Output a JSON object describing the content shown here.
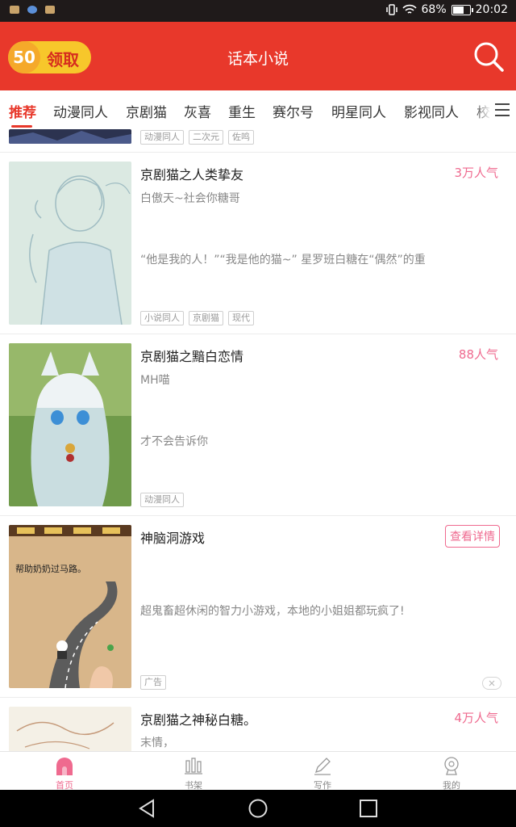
{
  "status_bar": {
    "battery": "68%",
    "time": "20:02"
  },
  "header": {
    "coins": "50",
    "claim_label": "领取",
    "title": "话本小说"
  },
  "tabs": [
    "推荐",
    "动漫同人",
    "京剧猫",
    "灰喜",
    "重生",
    "赛尔号",
    "明星同人",
    "影视同人",
    "校园"
  ],
  "partial_tags": [
    "动漫同人",
    "二次元",
    "佐鸣"
  ],
  "books": [
    {
      "title": "京剧猫之人类挚友",
      "popularity": "3万人气",
      "author": "白傲天~社会你糖哥",
      "desc": "“他是我的人！”“我是他的猫~” 星罗班白糖在“偶然”的重",
      "tags": [
        "小说同人",
        "京剧猫",
        "现代"
      ]
    },
    {
      "title": "京剧猫之黯白恋情",
      "popularity": "88人气",
      "author": "MH喵",
      "desc": "才不会告诉你",
      "tags": [
        "动漫同人"
      ]
    },
    {
      "title": "京剧猫之神秘白糖。",
      "popularity": "4万人气",
      "author": "末情，"
    }
  ],
  "ad": {
    "title": "神脑洞游戏",
    "button": "查看详情",
    "desc": "超鬼畜超休闲的智力小游戏，本地的小姐姐都玩疯了!",
    "tag": "广告",
    "image_text": "帮助奶奶过马路。"
  },
  "bottom_nav": [
    "首页",
    "书架",
    "写作",
    "我的"
  ],
  "colors": {
    "brand_red": "#e8382b",
    "accent_pink": "#ef6a8f",
    "coin_yellow": "#f7c72b"
  }
}
